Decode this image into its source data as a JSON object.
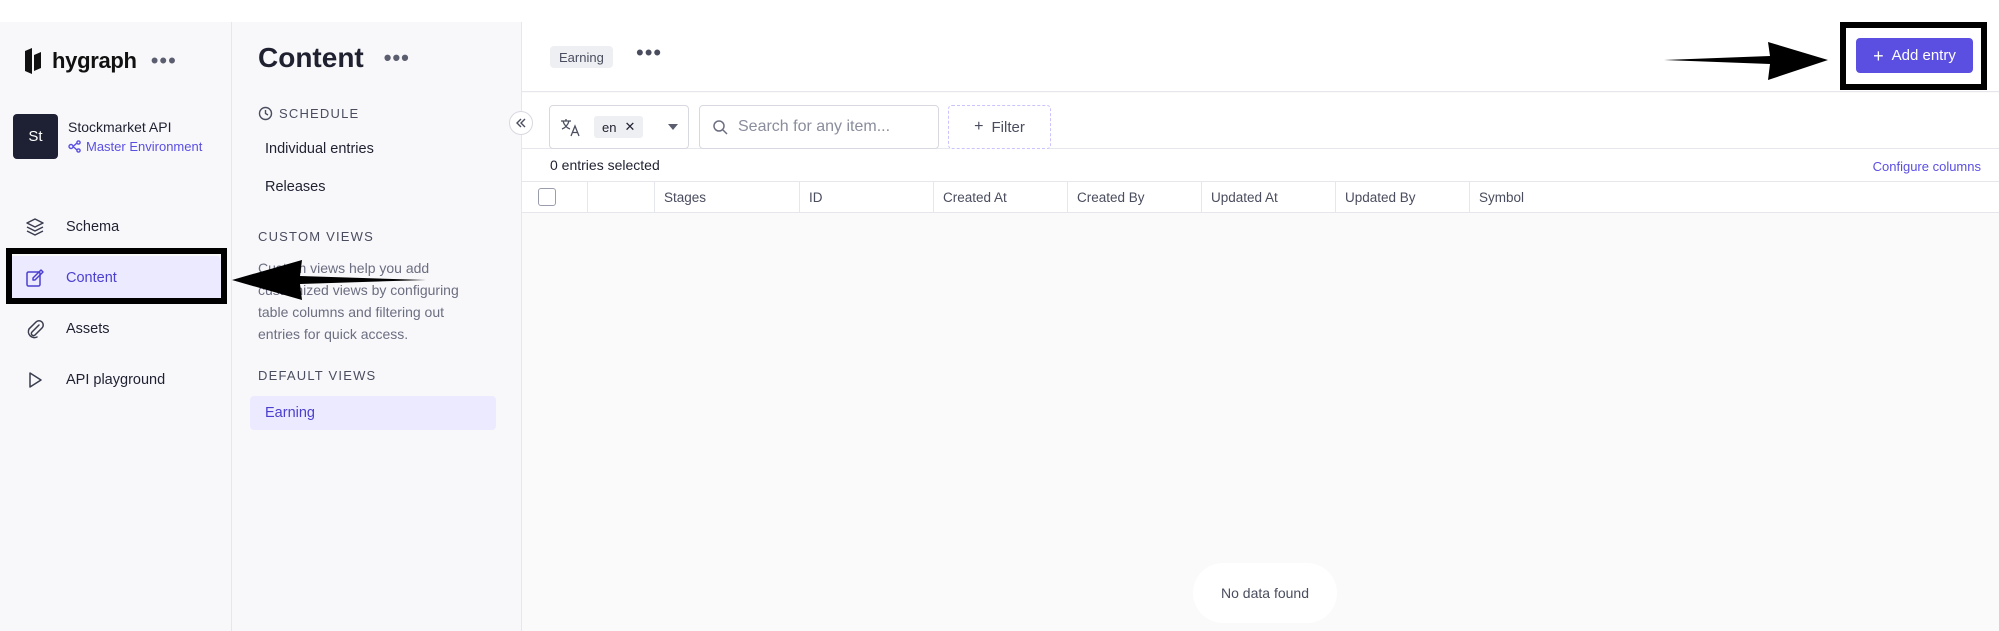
{
  "brand": {
    "name": "hygraph"
  },
  "project": {
    "initials": "St",
    "name": "Stockmarket API",
    "environment": "Master Environment"
  },
  "nav": {
    "items": [
      {
        "label": "Schema",
        "icon": "layers-icon",
        "active": false
      },
      {
        "label": "Content",
        "icon": "edit-icon",
        "active": true
      },
      {
        "label": "Assets",
        "icon": "paperclip-icon",
        "active": false
      },
      {
        "label": "API playground",
        "icon": "play-icon",
        "active": false
      }
    ]
  },
  "subbar": {
    "title": "Content",
    "schedule_heading": "SCHEDULE",
    "schedule_links": [
      "Individual entries",
      "Releases"
    ],
    "custom_heading": "CUSTOM VIEWS",
    "custom_description": "Custom views help you add customized views by configuring table columns and filtering out entries for quick access.",
    "default_heading": "DEFAULT VIEWS",
    "default_item": "Earning"
  },
  "main": {
    "view_chip": "Earning",
    "add_entry_label": "Add entry",
    "locale": "en",
    "search_placeholder": "Search for any item...",
    "filter_label": "Filter",
    "selected_text": "0 entries selected",
    "configure_columns": "Configure columns",
    "columns": [
      "Stages",
      "ID",
      "Created At",
      "Created By",
      "Updated At",
      "Updated By",
      "Symbol"
    ],
    "empty_text": "No data found"
  },
  "colors": {
    "accent": "#5b4fe2",
    "active_bg": "#eceaff",
    "sidebar_bg": "#f8f8fb"
  }
}
